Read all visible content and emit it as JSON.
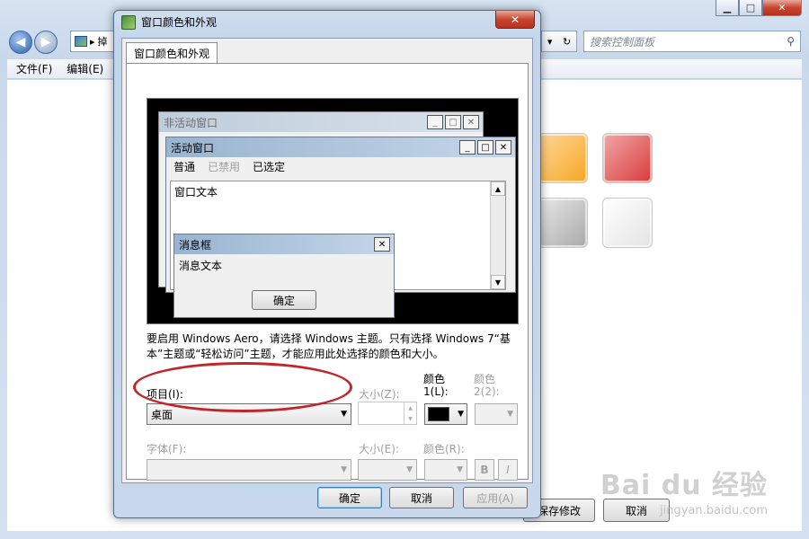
{
  "explorer": {
    "search_placeholder": "搜索控制面板",
    "addr_separator": "▸",
    "addr_fragment": "掉",
    "menu": [
      "文件(F)",
      "编辑(E)"
    ],
    "bottom_buttons": {
      "save": "保存修改",
      "cancel": "取消"
    }
  },
  "watermark": {
    "brand": "Bai du 经验",
    "url": "jingyan.baidu.com"
  },
  "dialog": {
    "title": "窗口颜色和外观",
    "tab": "窗口颜色和外观",
    "preview": {
      "inactive_title": "非活动窗口",
      "active_title": "活动窗口",
      "menu_normal": "普通",
      "menu_disabled": "已禁用",
      "menu_selected": "已选定",
      "window_text": "窗口文本",
      "msgbox_title": "消息框",
      "msgbox_text": "消息文本",
      "msgbox_ok": "确定"
    },
    "description": "要启用 Windows Aero，请选择 Windows 主题。只有选择 Windows 7“基本”主题或“轻松访问”主题，才能应用此处选择的颜色和大小。",
    "item_label": "项目(I):",
    "item_value": "桌面",
    "size_label": "大小(Z):",
    "color1_label_a": "颜色",
    "color1_label_b": "1(L):",
    "color2_label_a": "颜色",
    "color2_label_b": "2(2):",
    "color1_value": "#000000",
    "font_label": "字体(F):",
    "font_size_label": "大小(E):",
    "font_color_label": "颜色(R):",
    "bold": "B",
    "italic": "I",
    "ok": "确定",
    "cancel": "取消",
    "apply": "应用(A)"
  }
}
